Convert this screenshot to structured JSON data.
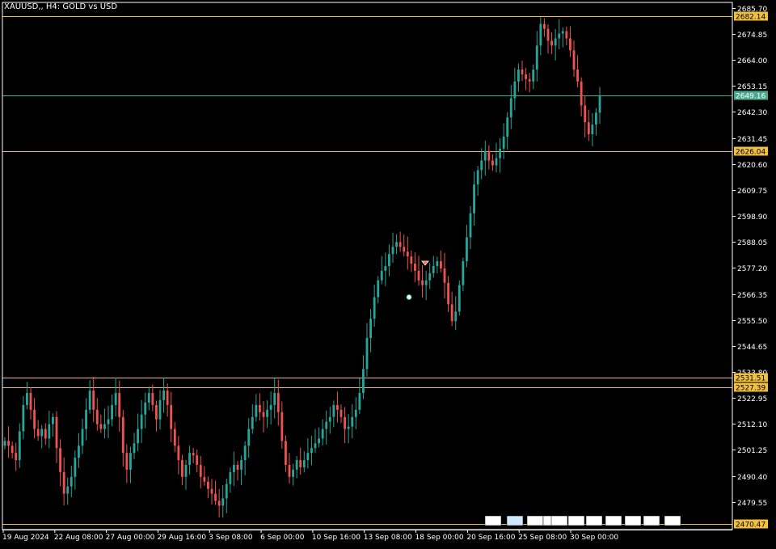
{
  "window": {
    "title": "XAUUSD,, H4:  GOLD vs USD"
  },
  "colors": {
    "background": "#000000",
    "bull_candle": "#26a69a",
    "bear_candle": "#ef5350",
    "axis": "#ffffff",
    "level_line": "#f0c040",
    "current_price_line": "#4aa88f",
    "label_text": "#000000"
  },
  "chart_data": {
    "type": "candlestick",
    "symbol": "XAUUSD",
    "timeframe": "H4",
    "ylim": [
      2468.0,
      2688.0
    ],
    "y_ticks": [
      2685.7,
      2674.85,
      2664.0,
      2653.15,
      2642.3,
      2631.45,
      2620.6,
      2609.75,
      2598.9,
      2588.05,
      2577.2,
      2566.35,
      2555.5,
      2544.65,
      2533.8,
      2522.95,
      2512.1,
      2501.25,
      2490.4,
      2479.55
    ],
    "x_labels": [
      "19 Aug 2024",
      "22 Aug 08:00",
      "27 Aug 00:00",
      "29 Aug 16:00",
      "3 Sep 08:00",
      "6 Sep 00:00",
      "10 Sep 16:00",
      "13 Sep 08:00",
      "18 Sep 00:00",
      "20 Sep 16:00",
      "25 Sep 08:00",
      "30 Sep 00:00"
    ],
    "horizontal_levels": [
      {
        "price": 2682.14,
        "label": "2682.14",
        "kind": "level"
      },
      {
        "price": 2649.16,
        "label": "2649.16",
        "kind": "current"
      },
      {
        "price": 2626.04,
        "label": "2626.04",
        "kind": "level"
      },
      {
        "price": 2531.51,
        "label": "2531.51",
        "kind": "level"
      },
      {
        "price": 2527.39,
        "label": "2527.39",
        "kind": "level"
      },
      {
        "price": 2470.47,
        "label": "2470.47",
        "kind": "level"
      }
    ],
    "closes": [
      2505,
      2503,
      2500,
      2497,
      2509,
      2520,
      2525,
      2518,
      2510,
      2507,
      2510,
      2506,
      2512,
      2515,
      2502,
      2492,
      2483,
      2486,
      2490,
      2498,
      2503,
      2510,
      2518,
      2526,
      2518,
      2512,
      2510,
      2512,
      2514,
      2520,
      2525,
      2515,
      2500,
      2493,
      2500,
      2504,
      2510,
      2516,
      2521,
      2525,
      2520,
      2514,
      2522,
      2526,
      2520,
      2510,
      2503,
      2497,
      2490,
      2495,
      2500,
      2499,
      2495,
      2490,
      2488,
      2485,
      2483,
      2480,
      2478,
      2481,
      2487,
      2492,
      2495,
      2493,
      2497,
      2503,
      2510,
      2515,
      2520,
      2517,
      2515,
      2518,
      2520,
      2525,
      2517,
      2505,
      2495,
      2490,
      2493,
      2497,
      2494,
      2497,
      2500,
      2502,
      2504,
      2506,
      2510,
      2513,
      2515,
      2520,
      2518,
      2515,
      2510,
      2511,
      2515,
      2518,
      2525,
      2535,
      2548,
      2556,
      2565,
      2572,
      2576,
      2578,
      2583,
      2586,
      2588,
      2586,
      2584,
      2582,
      2579,
      2576,
      2572,
      2570,
      2572,
      2575,
      2578,
      2580,
      2577,
      2571,
      2562,
      2555,
      2559,
      2570,
      2580,
      2590,
      2600,
      2612,
      2618,
      2622,
      2626,
      2622,
      2620,
      2623,
      2627,
      2632,
      2640,
      2648,
      2655,
      2660,
      2658,
      2656,
      2655,
      2660,
      2670,
      2679,
      2677,
      2672,
      2670,
      2673,
      2675,
      2676,
      2673,
      2668,
      2660,
      2655,
      2645,
      2638,
      2633,
      2637,
      2642,
      2649
    ]
  }
}
